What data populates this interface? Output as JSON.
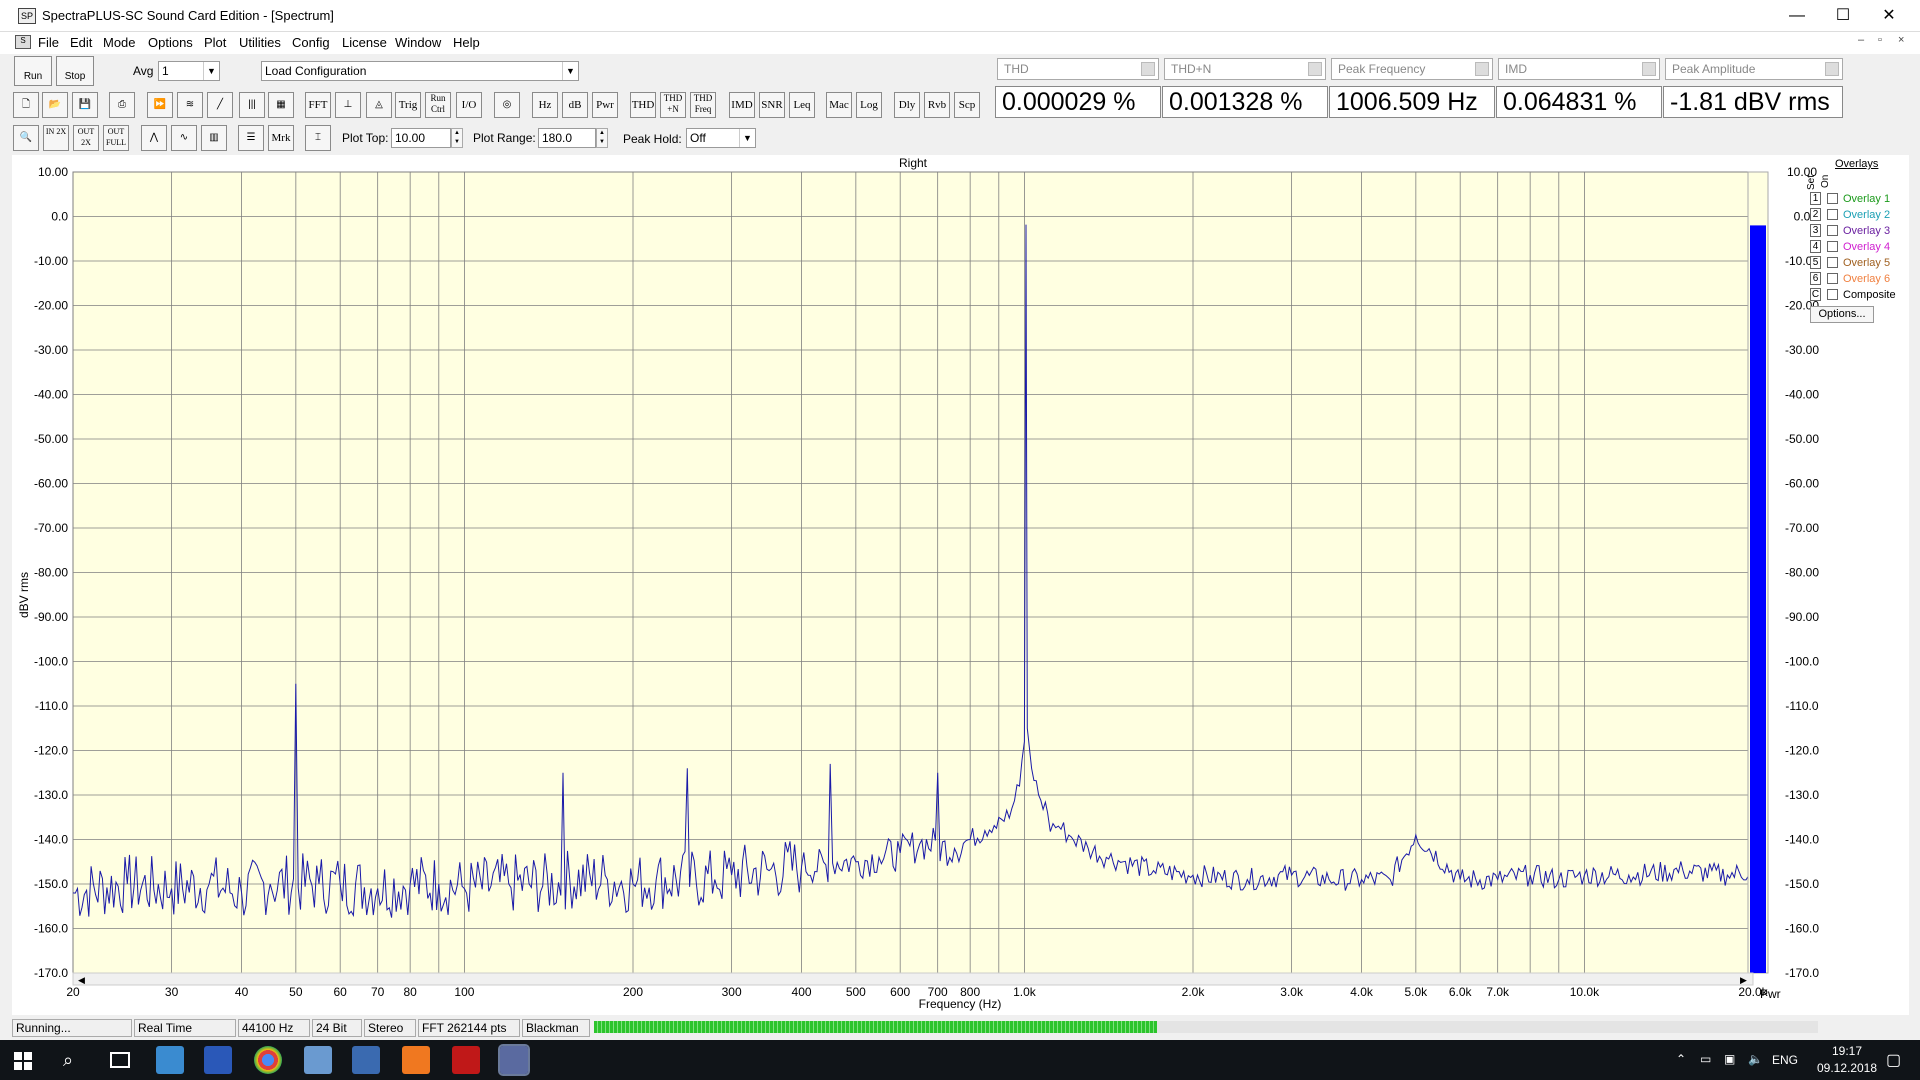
{
  "window": {
    "title": "SpectraPLUS-SC Sound Card Edition - [Spectrum]",
    "minimize": "—",
    "maximize": "☐",
    "close": "✕"
  },
  "menu": [
    "File",
    "Edit",
    "Mode",
    "Options",
    "Plot",
    "Utilities",
    "Config",
    "License",
    "Window",
    "Help"
  ],
  "mdi": {
    "min": "–",
    "restore": "▫",
    "close": "×"
  },
  "toolbar": {
    "run": "Run",
    "stop": "Stop",
    "avg_label": "Avg",
    "avg_value": "1",
    "config_value": "Load Configuration",
    "row2": [
      "FFT",
      "Trig",
      "Run Ctrl",
      "I/O",
      "Hz",
      "dB",
      "Pwr",
      "THD",
      "THD +N",
      "THD Freq",
      "IMD",
      "SNR",
      "Leq",
      "Mac",
      "Log",
      "Dly",
      "Rvb",
      "Scp"
    ],
    "row3": [
      "IN 2X",
      "OUT 2X",
      "OUT FULL",
      "Mrk"
    ],
    "plot_top_label": "Plot Top:",
    "plot_top_value": "10.00",
    "plot_range_label": "Plot Range:",
    "plot_range_value": "180.0",
    "peak_hold_label": "Peak Hold:",
    "peak_hold_value": "Off"
  },
  "meters": [
    {
      "label": "THD",
      "value": "0.000029 %"
    },
    {
      "label": "THD+N",
      "value": "0.001328 %"
    },
    {
      "label": "Peak Frequency",
      "value": "1006.509 Hz"
    },
    {
      "label": "IMD",
      "value": "0.064831 %"
    },
    {
      "label": "Peak Amplitude",
      "value": "-1.81 dBV rms"
    }
  ],
  "plot": {
    "title": "Right",
    "ylabel": "dBV rms",
    "xlabel": "Frequency (Hz)",
    "pwr_label": "Pwr",
    "y_ticks": [
      "10.00",
      "0.0",
      "-10.00",
      "-20.00",
      "-30.00",
      "-40.00",
      "-50.00",
      "-60.00",
      "-70.00",
      "-80.00",
      "-90.00",
      "-100.0",
      "-110.0",
      "-120.0",
      "-130.0",
      "-140.0",
      "-150.0",
      "-160.0",
      "-170.0"
    ],
    "x_ticks": [
      "20",
      "30",
      "40",
      "50",
      "60",
      "70",
      "80",
      "100",
      "200",
      "300",
      "400",
      "500",
      "600",
      "700",
      "800",
      "1.0k",
      "2.0k",
      "3.0k",
      "4.0k",
      "5.0k",
      "6.0k",
      "7.0k",
      "10.0k",
      "20.0k"
    ],
    "bg_color": "#ffffe1",
    "trace_color": "#1a1aa8",
    "bar_color": "#0000ff"
  },
  "chart_data": {
    "type": "line",
    "title": "Right",
    "xlabel": "Frequency (Hz)",
    "ylabel": "dBV rms",
    "x_scale": "log",
    "xlim": [
      20,
      20000
    ],
    "ylim": [
      -170,
      10
    ],
    "grid": true,
    "series": [
      {
        "values_note": "",
        "x": [
          20,
          25,
          30,
          35,
          40,
          45,
          50,
          55,
          60,
          70,
          80,
          90,
          100,
          120,
          150,
          180,
          200,
          220,
          250,
          280,
          300,
          350,
          400,
          450,
          500,
          550,
          600,
          650,
          700,
          750,
          800,
          850,
          900,
          950,
          980,
          1000,
          1006.5,
          1012,
          1030,
          1060,
          1100,
          1150,
          1200,
          1300,
          1400,
          1500,
          1700,
          2000,
          2500,
          3000,
          3500,
          4000,
          4500,
          5000,
          6000,
          7000,
          8000,
          9000,
          10000,
          12000,
          15000,
          18000,
          20000
        ],
        "y": [
          -152,
          -150,
          -151,
          -150,
          -152,
          -150,
          -105,
          -150,
          -150,
          -151,
          -150,
          -150,
          -151,
          -150,
          -125,
          -149,
          -150,
          -149,
          -124,
          -149,
          -148,
          -147,
          -146,
          -123,
          -145,
          -144,
          -143,
          -141,
          -125,
          -142,
          -140,
          -138,
          -135,
          -133,
          -128,
          -118,
          -1.81,
          -115,
          -124,
          -130,
          -134,
          -137,
          -139,
          -142,
          -144,
          -145,
          -147,
          -148,
          -149,
          -148,
          -149,
          -149,
          -149,
          -139,
          -149,
          -149,
          -148,
          -149,
          -148,
          -148,
          -147,
          -148,
          -147
        ]
      }
    ],
    "power_bar_top": -2
  },
  "overlays": {
    "title": "Overlays",
    "set_label": "Set",
    "on_label": "On",
    "options_btn": "Options...",
    "items": [
      {
        "num": "1",
        "name": "Overlay 1",
        "color": "#1c9a1c"
      },
      {
        "num": "2",
        "name": "Overlay 2",
        "color": "#1ca0b4"
      },
      {
        "num": "3",
        "name": "Overlay 3",
        "color": "#6a20a0"
      },
      {
        "num": "4",
        "name": "Overlay 4",
        "color": "#d020d0"
      },
      {
        "num": "5",
        "name": "Overlay 5",
        "color": "#a06020"
      },
      {
        "num": "6",
        "name": "Overlay 6",
        "color": "#f08040"
      },
      {
        "num": "C",
        "name": "Composite",
        "color": "#000000"
      }
    ]
  },
  "status": [
    "Running...",
    "Real Time",
    "44100 Hz",
    "24 Bit",
    "Stereo",
    "FFT 262144 pts",
    "Blackman"
  ],
  "status_level": 0.46,
  "taskbar": {
    "lang": "ENG",
    "time": "19:17",
    "date": "09.12.2018"
  }
}
